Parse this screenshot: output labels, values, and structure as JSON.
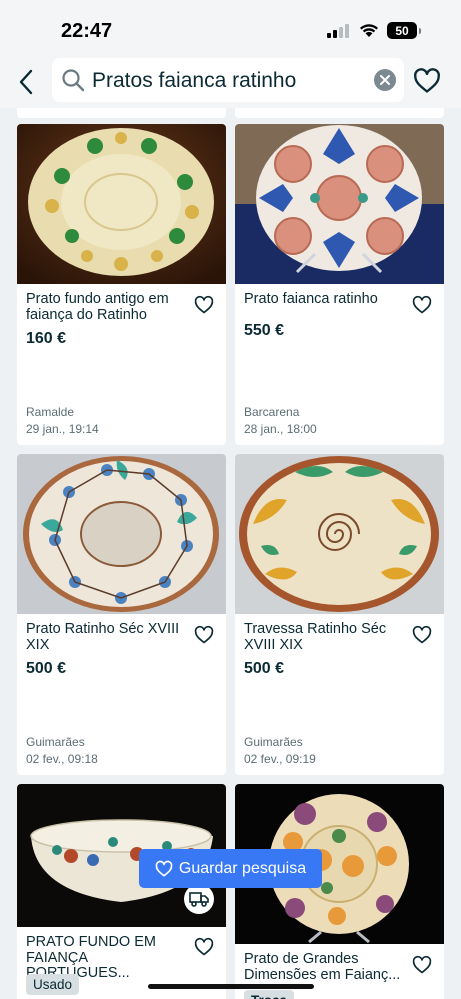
{
  "status_bar": {
    "time": "22:47",
    "battery": "50"
  },
  "search": {
    "query": "Pratos faianca ratinho"
  },
  "listings": [
    {
      "title": "Prato fundo antigo em faiança do Ratinho",
      "price": "160 €",
      "location": "Ramalde",
      "date": "29 jan., 19:14"
    },
    {
      "title": "Prato faianca ratinho",
      "price": "550 €",
      "location": "Barcarena",
      "date": "28 jan., 18:00"
    },
    {
      "title": "Prato Ratinho Séc XVIII XIX",
      "price": "500 €",
      "location": "Guimarães",
      "date": "02 fev., 09:18"
    },
    {
      "title": "Travessa Ratinho Séc XVIII XIX",
      "price": "500 €",
      "location": "Guimarães",
      "date": "02 fev., 09:19"
    },
    {
      "title": "PRATO FUNDO EM FAIANÇA PORTUGUES...",
      "condition": "Usado"
    },
    {
      "title": "Prato de Grandes Dimensões em Faianç...",
      "condition": "Troca"
    }
  ],
  "save_search": {
    "label": "Guardar pesquisa"
  },
  "icons": {
    "back": "chevron-left-icon",
    "search": "search-icon",
    "clear": "clear-icon",
    "favorite": "heart-outline-icon",
    "delivery": "delivery-truck-icon"
  },
  "colors": {
    "accent_blue": "#3878f4",
    "text_dark": "#0b2a33",
    "page_bg": "#eef1f4"
  }
}
